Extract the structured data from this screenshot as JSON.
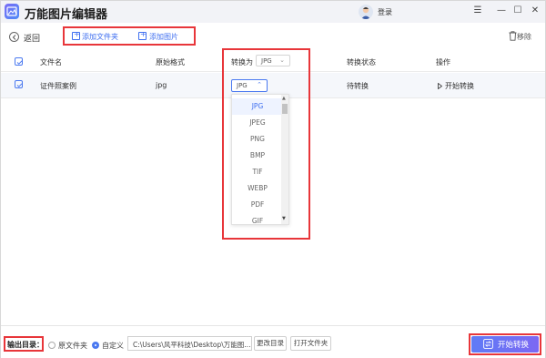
{
  "app": {
    "title": "万能图片编辑器",
    "login": "登录"
  },
  "window_controls": {
    "menu": "☰",
    "minimize": "—",
    "maximize": "☐",
    "close": "✕"
  },
  "toolbar": {
    "back": "返回",
    "add_folder": "添加文件夹",
    "add_image": "添加图片",
    "remove": "移除"
  },
  "table": {
    "headers": {
      "filename": "文件名",
      "format": "原始格式",
      "convert_to": "转换为",
      "status": "转换状态",
      "action": "操作"
    },
    "header_format_value": "JPG",
    "rows": [
      {
        "filename": "证件照案例",
        "format": "jpg",
        "target": "JPG",
        "status": "待转换",
        "action": "开始转换"
      }
    ]
  },
  "dropdown": {
    "options": [
      "JPG",
      "JPEG",
      "PNG",
      "BMP",
      "TIF",
      "WEBP",
      "PDF",
      "GIF"
    ],
    "selected": "JPG"
  },
  "footer": {
    "output_label": "输出目录：",
    "option_source": "原文件夹",
    "option_custom": "自定义",
    "path": "C:\\Users\\风平科技\\Desktop\\万能图...",
    "change_dir": "更改目录",
    "open_folder": "打开文件夹",
    "start": "开始转换"
  },
  "colors": {
    "accent": "#3e6ef0",
    "highlight": "#e8363a",
    "start_gradient": [
      "#5f7bf6",
      "#7c68f3"
    ]
  }
}
